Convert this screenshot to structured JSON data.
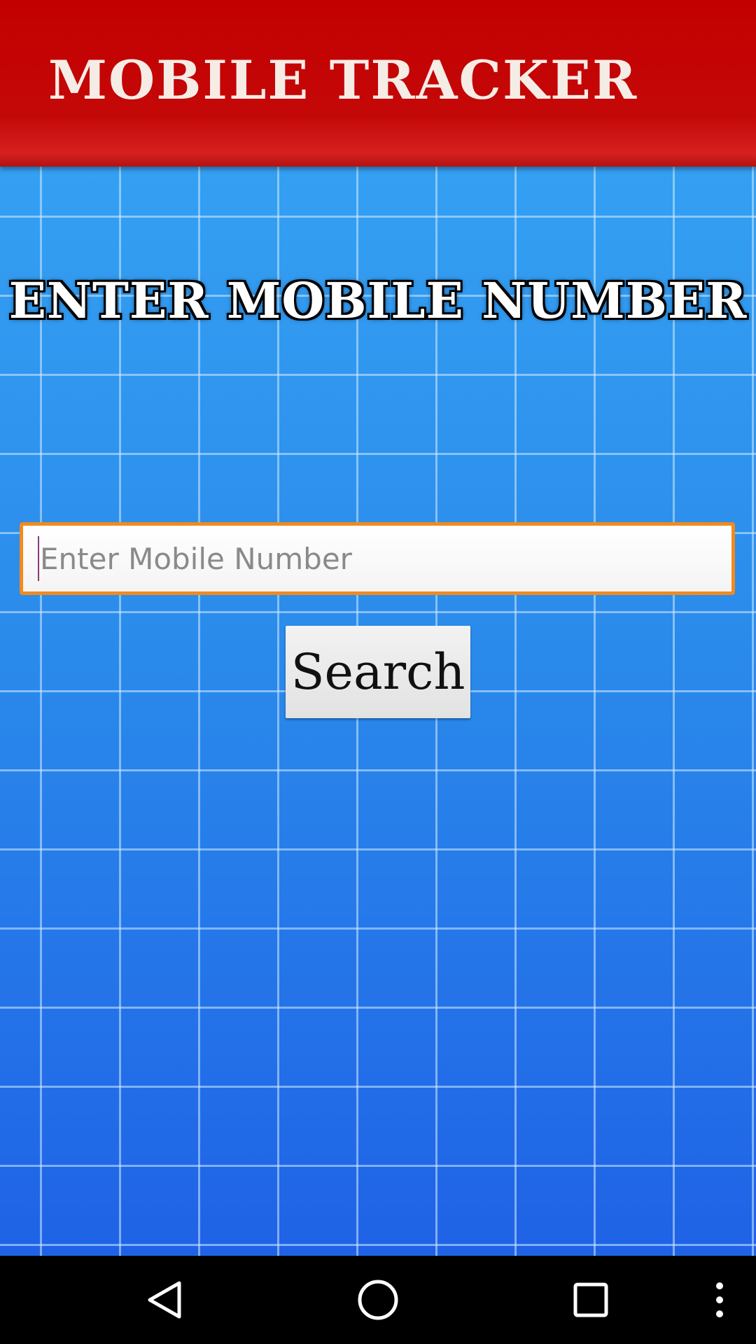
{
  "header": {
    "title": "MOBILE TRACKER"
  },
  "main": {
    "subtitle": "ENTER MOBILE NUMBER",
    "mobile_input": {
      "placeholder": "Enter Mobile Number",
      "value": ""
    },
    "search_label": "Search"
  },
  "navbar": {
    "icons": [
      "back-icon",
      "home-icon",
      "recents-icon",
      "more-options-icon"
    ]
  },
  "colors": {
    "header": "#c40808",
    "background_top": "#34a0f2",
    "background_bottom": "#1f62e6",
    "input_border": "#f28a1c",
    "navbar": "#000000"
  }
}
